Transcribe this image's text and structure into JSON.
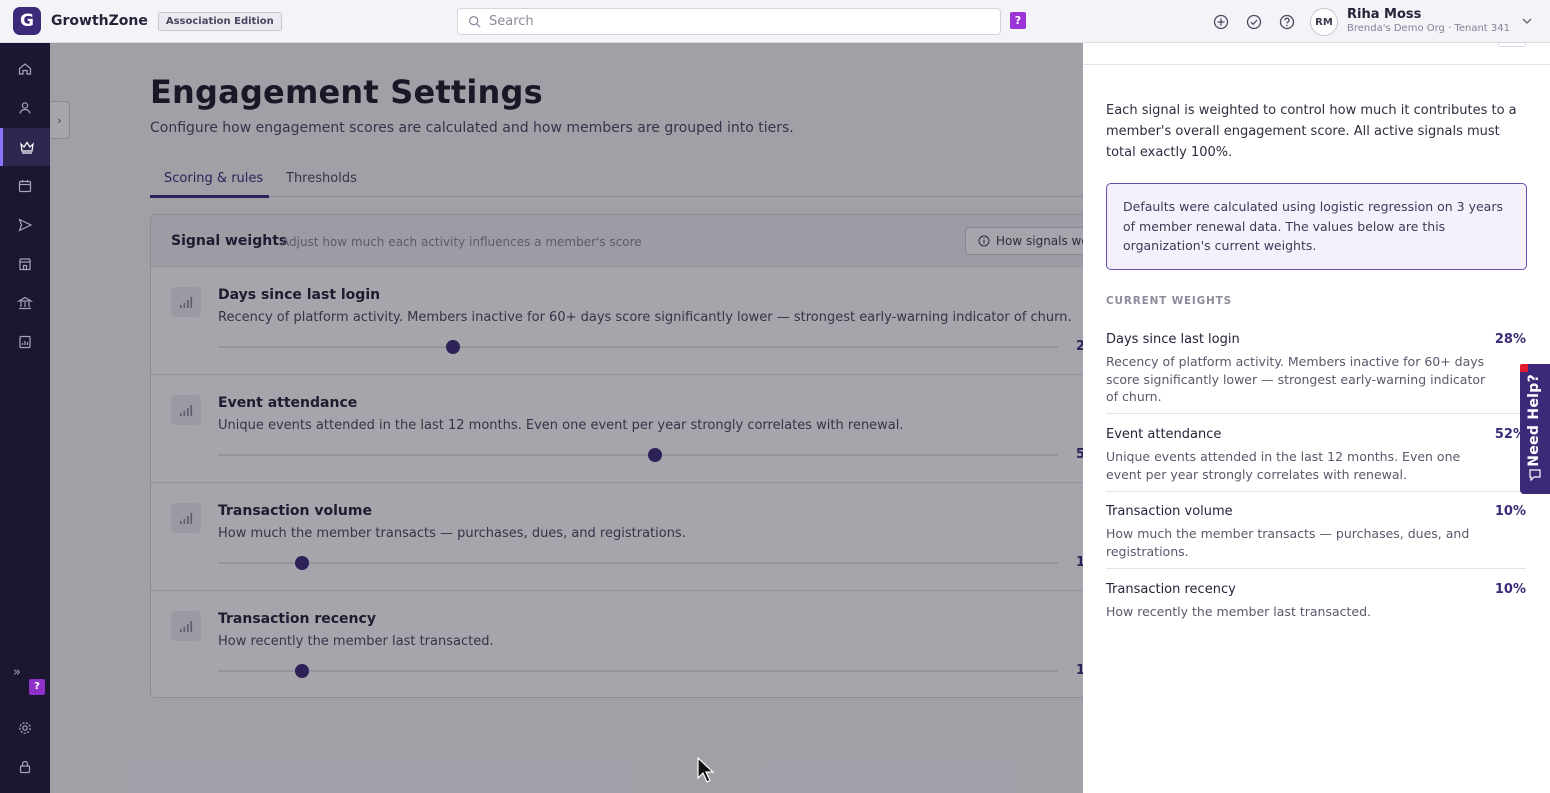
{
  "topbar": {
    "logo_letter": "G",
    "brand": "GrowthZone",
    "edition": "Association Edition",
    "search_placeholder": "Search",
    "help_badge": "?",
    "user_initials": "RM",
    "user_name": "Riha Moss",
    "user_org": "Brenda's Demo Org · Tenant 341"
  },
  "sidebar": {
    "items": [
      "home-icon",
      "person-icon",
      "crown-icon",
      "calendar-icon",
      "send-icon",
      "store-icon",
      "bank-icon",
      "report-icon"
    ],
    "active_index": 2,
    "help_badge": "?"
  },
  "main": {
    "title": "Engagement Settings",
    "subtitle": "Configure how engagement scores are calculated and how members are grouped into tiers.",
    "tabs": [
      {
        "label": "Scoring & rules",
        "active": true
      },
      {
        "label": "Thresholds",
        "active": false
      }
    ],
    "card": {
      "title": "Signal weights",
      "hint": "Adjust how much each activity influences a member's score",
      "how_button": "How signals wor",
      "signals": [
        {
          "name": "Days since last login",
          "desc": "Recency of platform activity. Members inactive for 60+ days score significantly lower — strongest early-warning indicator of churn.",
          "value_visible": "2",
          "slider_fraction": 0.28
        },
        {
          "name": "Event attendance",
          "desc": "Unique events attended in the last 12 months. Even one event per year strongly correlates with renewal.",
          "value_visible": "5",
          "slider_fraction": 0.52
        },
        {
          "name": "Transaction volume",
          "desc": "How much the member transacts — purchases, dues, and registrations.",
          "value_visible": "1",
          "slider_fraction": 0.1
        },
        {
          "name": "Transaction recency",
          "desc": "How recently the member last transacted.",
          "value_visible": "1",
          "slider_fraction": 0.1
        }
      ]
    }
  },
  "panel": {
    "intro": "Each signal is weighted to control how much it contributes to a member's overall engagement score. All active signals must total exactly 100%.",
    "note": "Defaults were calculated using logistic regression on 3 years of member renewal data. The values below are this organization's current weights.",
    "section_label": "CURRENT WEIGHTS",
    "weights": [
      {
        "name": "Days since last login",
        "pct": "28%",
        "desc": "Recency of platform activity. Members inactive for 60+ days score significantly lower — strongest early-warning indicator of churn."
      },
      {
        "name": "Event attendance",
        "pct": "52%",
        "desc": "Unique events attended in the last 12 months. Even one event per year strongly correlates with renewal."
      },
      {
        "name": "Transaction volume",
        "pct": "10%",
        "desc": "How much the member transacts — purchases, dues, and registrations."
      },
      {
        "name": "Transaction recency",
        "pct": "10%",
        "desc": "How recently the member last transacted."
      }
    ]
  },
  "help_tab": {
    "label": "Need Help?"
  },
  "colors": {
    "accent": "#3c2a78",
    "sidebar_bg": "#1b1730",
    "help_badge": "#9b34d8"
  }
}
